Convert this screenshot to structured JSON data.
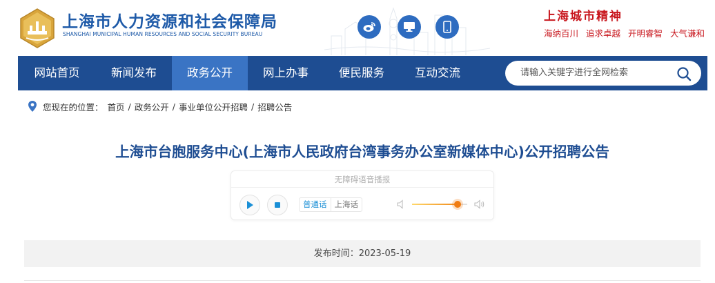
{
  "header": {
    "site_title": "上海市人力资源和社会保障局",
    "site_subtitle": "SHANGHAI MUNICIPAL HUMAN RESOURCES AND SOCIAL SECURITY BUREAU",
    "icons": [
      "weibo-icon",
      "monitor-icon",
      "mobile-icon"
    ],
    "spirit_title": "上海城市精神",
    "spirit_words": [
      "海纳百川",
      "追求卓越",
      "开明睿智",
      "大气谦和"
    ]
  },
  "nav": {
    "items": [
      {
        "label": "网站首页",
        "active": false
      },
      {
        "label": "新闻发布",
        "active": false
      },
      {
        "label": "政务公开",
        "active": true
      },
      {
        "label": "网上办事",
        "active": false
      },
      {
        "label": "便民服务",
        "active": false
      },
      {
        "label": "互动交流",
        "active": false
      }
    ],
    "search_placeholder": "请输入关键字进行全网检索"
  },
  "breadcrumb": {
    "prefix": "您现在的位置：",
    "items": [
      "首页",
      "政务公开",
      "事业单位公开招聘",
      "招聘公告"
    ]
  },
  "article": {
    "title": "上海市台胞服务中心(上海市人民政府台湾事务办公室新媒体中心)公开招聘公告",
    "publish_label": "发布时间：",
    "publish_date": "2023-05-19"
  },
  "player": {
    "header": "无障碍语音播报",
    "lang_options": [
      "普通话",
      "上海话"
    ],
    "selected_lang": "普通话",
    "volume": 0.82
  },
  "colors": {
    "brand_blue": "#1e4d92",
    "nav_active": "#3a74c4",
    "accent_red": "#c8161d",
    "volume_orange": "#f07c12"
  }
}
